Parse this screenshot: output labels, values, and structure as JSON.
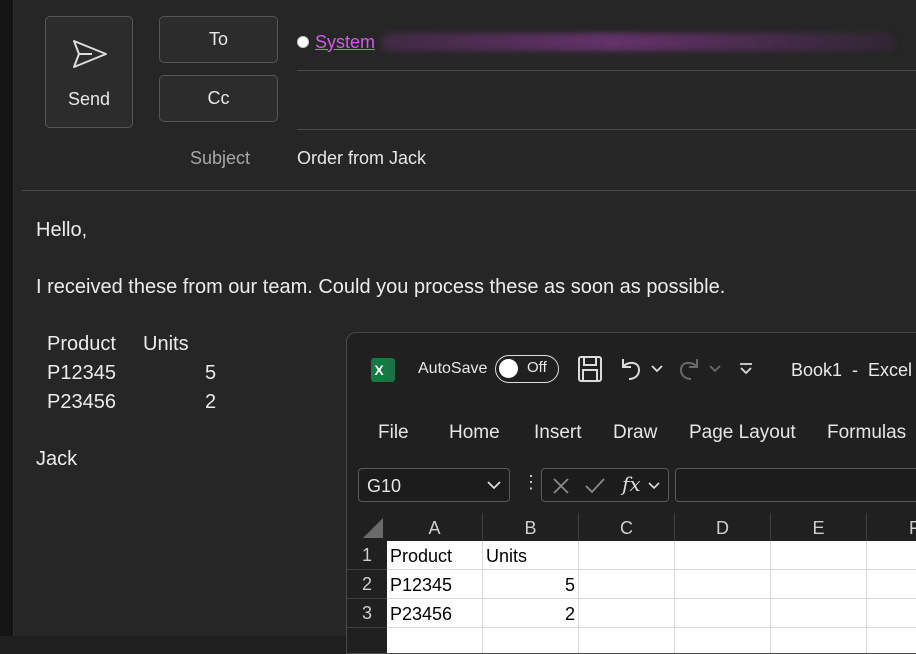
{
  "compose": {
    "send_label": "Send",
    "to_label": "To",
    "cc_label": "Cc",
    "recipient": "System",
    "subject_label": "Subject",
    "subject_value": "Order from Jack"
  },
  "body": {
    "greeting": "Hello,",
    "message": "I received these from our team. Could you process these as soon as possible.",
    "table": {
      "headers": [
        "Product",
        "Units"
      ],
      "rows": [
        [
          "P12345",
          "5"
        ],
        [
          "P23456",
          "2"
        ]
      ]
    },
    "signature": "Jack"
  },
  "excel": {
    "app_icon": "X",
    "autosave_label": "AutoSave",
    "autosave_state": "Off",
    "title": "Book1  -  Excel",
    "ribbon_tabs": [
      "File",
      "Home",
      "Insert",
      "Draw",
      "Page Layout",
      "Formulas"
    ],
    "name_box": "G10",
    "column_headers": [
      "A",
      "B",
      "C",
      "D",
      "E",
      "F"
    ],
    "row_headers": [
      "1",
      "2",
      "3"
    ],
    "cells": [
      [
        "Product",
        "Units"
      ],
      [
        "P12345",
        "5"
      ],
      [
        "P23456",
        "2"
      ]
    ]
  }
}
